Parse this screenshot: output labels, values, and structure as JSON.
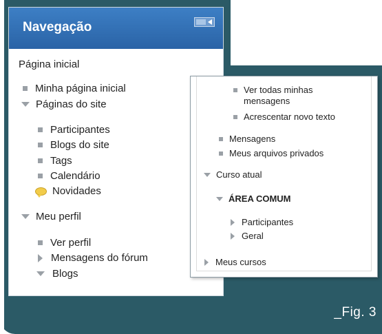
{
  "nav": {
    "title": "Navegação",
    "home": "Página inicial",
    "my_home": "Minha página inicial",
    "site_pages": "Páginas do site",
    "participants": "Participantes",
    "site_blogs": "Blogs do site",
    "tags": "Tags",
    "calendar": "Calendário",
    "news": "Novidades",
    "my_profile": "Meu perfil",
    "view_profile": "Ver perfil",
    "forum_posts": "Mensagens do fórum",
    "blogs": "Blogs"
  },
  "overlay": {
    "view_all_line1": "Ver todas minhas",
    "view_all_line2": "mensagens",
    "add_text": "Acrescentar novo texto",
    "messages": "Mensagens",
    "private_files": "Meus arquivos privados",
    "current_course": "Curso atual",
    "area_comum": "ÁREA COMUM",
    "participants": "Participantes",
    "general": "Geral",
    "my_courses": "Meus cursos"
  },
  "caption": "_Fig. 3",
  "colors": {
    "frame_teal": "#2b5a66",
    "header_blue": "#2e6bb0",
    "icon_gray": "#9aa0a6"
  }
}
